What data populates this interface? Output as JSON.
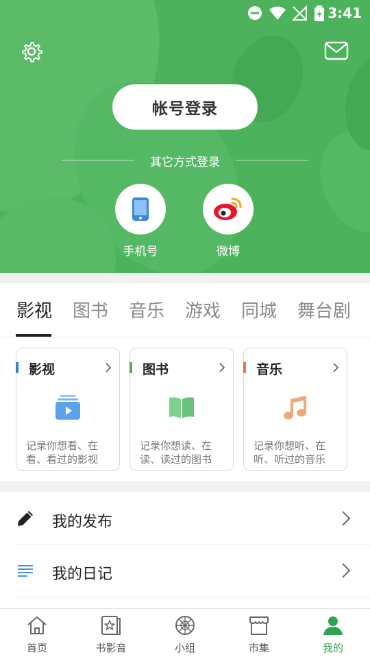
{
  "status_bar": {
    "time": "3:41"
  },
  "header": {
    "login_button": "帐号登录",
    "other_methods": "其它方式登录",
    "methods": [
      {
        "label": "手机号",
        "icon": "phone-icon"
      },
      {
        "label": "微博",
        "icon": "weibo-icon"
      }
    ]
  },
  "tabs": [
    "影视",
    "图书",
    "音乐",
    "游戏",
    "同城",
    "舞台剧"
  ],
  "cards": [
    {
      "title": "影视",
      "desc": "记录你想看、在看、看过的影视",
      "accent": "#3a7fd5",
      "icon": "video-stack-icon"
    },
    {
      "title": "图书",
      "desc": "记录你想读、在读、读过的图书",
      "accent": "#4caf50",
      "icon": "open-book-icon"
    },
    {
      "title": "音乐",
      "desc": "记录你想听、在听、听过的音乐",
      "accent": "#e07b39",
      "icon": "music-note-icon"
    }
  ],
  "menu": [
    {
      "label": "我的发布",
      "icon": "pencil-icon"
    },
    {
      "label": "我的日记",
      "icon": "list-lines-icon"
    }
  ],
  "bottom_nav": [
    {
      "label": "首页",
      "icon": "home-icon"
    },
    {
      "label": "书影音",
      "icon": "star-book-icon"
    },
    {
      "label": "小组",
      "icon": "ball-icon"
    },
    {
      "label": "市集",
      "icon": "shop-icon"
    },
    {
      "label": "我的",
      "icon": "person-icon",
      "active": true
    }
  ],
  "colors": {
    "header": "#4cb35c",
    "active": "#2fa44f"
  }
}
